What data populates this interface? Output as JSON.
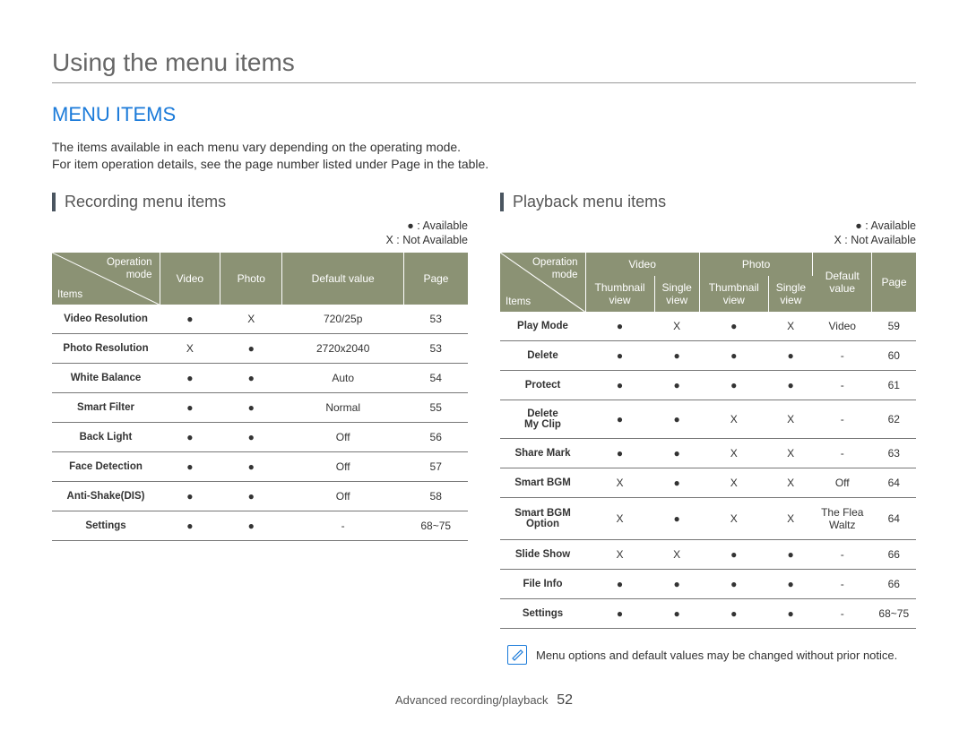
{
  "page_title": "Using the menu items",
  "section_heading": "MENU ITEMS",
  "intro_lines": [
    "The items available in each menu vary depending on the operating mode.",
    "For item operation details, see the page number listed under Page in the table."
  ],
  "legend": "● : Available\nX : Not Available",
  "recording": {
    "subhead": "Recording menu items",
    "corner": {
      "top": "Operation\nmode",
      "bottom": "Items"
    },
    "columns": [
      "Video",
      "Photo",
      "Default value",
      "Page"
    ],
    "rows": [
      {
        "item": "Video Resolution",
        "video": "●",
        "photo": "X",
        "default": "720/25p",
        "page": "53"
      },
      {
        "item": "Photo Resolution",
        "video": "X",
        "photo": "●",
        "default": "2720x2040",
        "page": "53"
      },
      {
        "item": "White Balance",
        "video": "●",
        "photo": "●",
        "default": "Auto",
        "page": "54"
      },
      {
        "item": "Smart Filter",
        "video": "●",
        "photo": "●",
        "default": "Normal",
        "page": "55"
      },
      {
        "item": "Back Light",
        "video": "●",
        "photo": "●",
        "default": "Off",
        "page": "56"
      },
      {
        "item": "Face Detection",
        "video": "●",
        "photo": "●",
        "default": "Off",
        "page": "57"
      },
      {
        "item": "Anti-Shake(DIS)",
        "video": "●",
        "photo": "●",
        "default": "Off",
        "page": "58"
      },
      {
        "item": "Settings",
        "video": "●",
        "photo": "●",
        "default": "-",
        "page": "68~75"
      }
    ]
  },
  "playback": {
    "subhead": "Playback menu items",
    "corner": {
      "top": "Operation\nmode",
      "bottom": "Items"
    },
    "group_columns": [
      "Video",
      "Photo"
    ],
    "sub_columns": [
      "Thumbnail\nview",
      "Single\nview",
      "Thumbnail\nview",
      "Single\nview"
    ],
    "extra_columns": [
      "Default\nvalue",
      "Page"
    ],
    "rows": [
      {
        "item": "Play Mode",
        "vt": "●",
        "vs": "X",
        "pt": "●",
        "ps": "X",
        "default": "Video",
        "page": "59"
      },
      {
        "item": "Delete",
        "vt": "●",
        "vs": "●",
        "pt": "●",
        "ps": "●",
        "default": "-",
        "page": "60"
      },
      {
        "item": "Protect",
        "vt": "●",
        "vs": "●",
        "pt": "●",
        "ps": "●",
        "default": "-",
        "page": "61"
      },
      {
        "item": "Delete\nMy Clip",
        "vt": "●",
        "vs": "●",
        "pt": "X",
        "ps": "X",
        "default": "-",
        "page": "62"
      },
      {
        "item": "Share Mark",
        "vt": "●",
        "vs": "●",
        "pt": "X",
        "ps": "X",
        "default": "-",
        "page": "63"
      },
      {
        "item": "Smart BGM",
        "vt": "X",
        "vs": "●",
        "pt": "X",
        "ps": "X",
        "default": "Off",
        "page": "64"
      },
      {
        "item": "Smart BGM\nOption",
        "vt": "X",
        "vs": "●",
        "pt": "X",
        "ps": "X",
        "default": "The Flea\nWaltz",
        "page": "64"
      },
      {
        "item": "Slide Show",
        "vt": "X",
        "vs": "X",
        "pt": "●",
        "ps": "●",
        "default": "-",
        "page": "66"
      },
      {
        "item": "File Info",
        "vt": "●",
        "vs": "●",
        "pt": "●",
        "ps": "●",
        "default": "-",
        "page": "66"
      },
      {
        "item": "Settings",
        "vt": "●",
        "vs": "●",
        "pt": "●",
        "ps": "●",
        "default": "-",
        "page": "68~75"
      }
    ]
  },
  "note": "Menu options and default values may be changed without prior notice.",
  "footer": {
    "section": "Advanced recording/playback",
    "page": "52"
  },
  "chart_data": [
    {
      "type": "table",
      "title": "Recording menu items",
      "columns": [
        "Items",
        "Video",
        "Photo",
        "Default value",
        "Page"
      ],
      "rows": [
        [
          "Video Resolution",
          "Available",
          "Not Available",
          "720/25p",
          53
        ],
        [
          "Photo Resolution",
          "Not Available",
          "Available",
          "2720x2040",
          53
        ],
        [
          "White Balance",
          "Available",
          "Available",
          "Auto",
          54
        ],
        [
          "Smart Filter",
          "Available",
          "Available",
          "Normal",
          55
        ],
        [
          "Back Light",
          "Available",
          "Available",
          "Off",
          56
        ],
        [
          "Face Detection",
          "Available",
          "Available",
          "Off",
          57
        ],
        [
          "Anti-Shake(DIS)",
          "Available",
          "Available",
          "Off",
          58
        ],
        [
          "Settings",
          "Available",
          "Available",
          "-",
          "68~75"
        ]
      ]
    },
    {
      "type": "table",
      "title": "Playback menu items",
      "columns": [
        "Items",
        "Video Thumbnail view",
        "Video Single view",
        "Photo Thumbnail view",
        "Photo Single view",
        "Default value",
        "Page"
      ],
      "rows": [
        [
          "Play Mode",
          "Available",
          "Not Available",
          "Available",
          "Not Available",
          "Video",
          59
        ],
        [
          "Delete",
          "Available",
          "Available",
          "Available",
          "Available",
          "-",
          60
        ],
        [
          "Protect",
          "Available",
          "Available",
          "Available",
          "Available",
          "-",
          61
        ],
        [
          "Delete My Clip",
          "Available",
          "Available",
          "Not Available",
          "Not Available",
          "-",
          62
        ],
        [
          "Share Mark",
          "Available",
          "Available",
          "Not Available",
          "Not Available",
          "-",
          63
        ],
        [
          "Smart BGM",
          "Not Available",
          "Available",
          "Not Available",
          "Not Available",
          "Off",
          64
        ],
        [
          "Smart BGM Option",
          "Not Available",
          "Available",
          "Not Available",
          "Not Available",
          "The Flea Waltz",
          64
        ],
        [
          "Slide Show",
          "Not Available",
          "Not Available",
          "Available",
          "Available",
          "-",
          66
        ],
        [
          "File Info",
          "Available",
          "Available",
          "Available",
          "Available",
          "-",
          66
        ],
        [
          "Settings",
          "Available",
          "Available",
          "Available",
          "Available",
          "-",
          "68~75"
        ]
      ]
    }
  ]
}
